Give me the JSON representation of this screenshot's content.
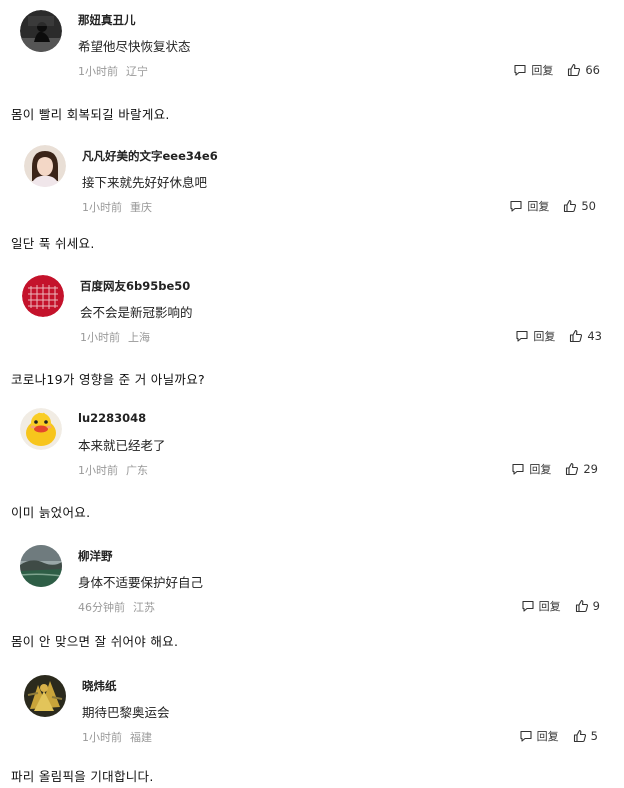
{
  "comments": [
    {
      "name": "那妞真丑儿",
      "text": "希望他尽快恢复状态",
      "time": "1小时前",
      "location": "辽宁",
      "reply_label": "回复",
      "likes": "66",
      "translation": "몸이 빨리 회복되길 바랄게요.",
      "avatar_icon": "silhouette-avatar"
    },
    {
      "name": "凡凡好美的文字eee34e6",
      "text": "接下来就先好好休息吧",
      "time": "1小时前",
      "location": "重庆",
      "reply_label": "回复",
      "likes": "50",
      "translation": "일단 푹 쉬세요.",
      "avatar_icon": "woman-portrait-avatar"
    },
    {
      "name": "百度网友6b95be50",
      "text": "会不会是新冠影响的",
      "time": "1小时前",
      "location": "上海",
      "reply_label": "回复",
      "likes": "43",
      "translation": "코로나19가 영향을 준 거 아닐까요?",
      "avatar_icon": "red-calligraphy-avatar"
    },
    {
      "name": "lu2283048",
      "text": "本来就已经老了",
      "time": "1小时前",
      "location": "广东",
      "reply_label": "回复",
      "likes": "29",
      "translation": "이미 늙었어요.",
      "avatar_icon": "yellow-duck-avatar"
    },
    {
      "name": "柳洋野",
      "text": "身体不适要保护好自己",
      "time": "46分钟前",
      "location": "江苏",
      "reply_label": "回复",
      "likes": "9",
      "translation": "몸이 안 맞으면 잘 쉬어야 해요.",
      "avatar_icon": "landscape-avatar"
    },
    {
      "name": "晓炜纸",
      "text": "期待巴黎奥运会",
      "time": "1小时前",
      "location": "福建",
      "reply_label": "回复",
      "likes": "5",
      "translation": "파리 올림픽을 기대합니다.",
      "avatar_icon": "golden-figure-avatar"
    }
  ]
}
